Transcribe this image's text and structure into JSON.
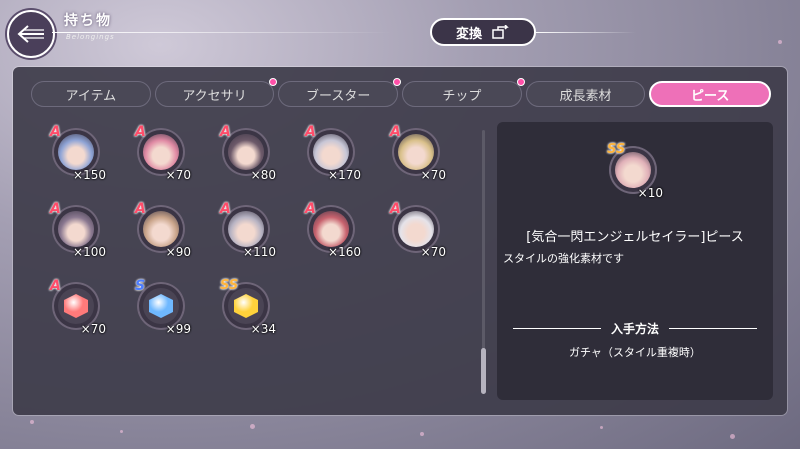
{
  "header": {
    "title": "持ち物",
    "subtitle": "Belongings",
    "convert_label": "変換"
  },
  "tabs": [
    {
      "label": "アイテム",
      "badge": false,
      "active": false
    },
    {
      "label": "アクセサリ",
      "badge": true,
      "active": false
    },
    {
      "label": "ブースター",
      "badge": true,
      "active": false
    },
    {
      "label": "チップ",
      "badge": true,
      "active": false
    },
    {
      "label": "成長素材",
      "badge": false,
      "active": false
    },
    {
      "label": "ピース",
      "badge": false,
      "active": true
    }
  ],
  "items": [
    {
      "rank": "A",
      "qty": "×150",
      "kind": "portrait",
      "color": "#8fa4d6"
    },
    {
      "rank": "A",
      "qty": "×70",
      "kind": "portrait",
      "color": "#e08aa4"
    },
    {
      "rank": "A",
      "qty": "×80",
      "kind": "portrait",
      "color": "#6d5a6a"
    },
    {
      "rank": "A",
      "qty": "×170",
      "kind": "portrait",
      "color": "#c7c6d6"
    },
    {
      "rank": "A",
      "qty": "×70",
      "kind": "portrait",
      "color": "#d9c08a"
    },
    {
      "rank": "A",
      "qty": "×100",
      "kind": "portrait",
      "color": "#8a7890"
    },
    {
      "rank": "A",
      "qty": "×90",
      "kind": "portrait",
      "color": "#c9a48a"
    },
    {
      "rank": "A",
      "qty": "×110",
      "kind": "portrait",
      "color": "#b7b3c3"
    },
    {
      "rank": "A",
      "qty": "×160",
      "kind": "portrait",
      "color": "#c7626e"
    },
    {
      "rank": "A",
      "qty": "×70",
      "kind": "portrait",
      "color": "#e5e3ea"
    },
    {
      "rank": "A",
      "qty": "×70",
      "kind": "gem",
      "color": "#ff7a7a"
    },
    {
      "rank": "S",
      "qty": "×99",
      "kind": "gem",
      "color": "#6fb8ff"
    },
    {
      "rank": "SS",
      "qty": "×34",
      "kind": "gem",
      "color": "#ffd23b"
    }
  ],
  "detail": {
    "rank": "SS",
    "qty": "×10",
    "portrait_color": "#e0b0b8",
    "name": "[気合一閃エンジェルセイラー]ピース",
    "description": "スタイルの強化素材です",
    "acquire_title": "入手方法",
    "acquire_value": "ガチャ（スタイル重複時）"
  },
  "colors": {
    "accent_pink": "#ee70b8",
    "rank_a": "#ff4d6a",
    "rank_s": "#4d7dff",
    "rank_ss": "#ffb43b"
  }
}
